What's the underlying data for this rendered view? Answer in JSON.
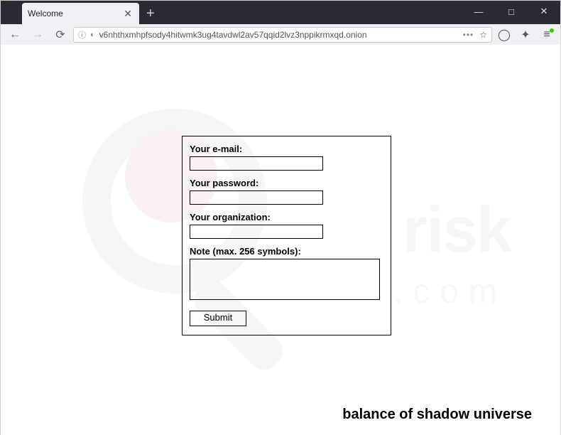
{
  "window": {
    "minimize": "—",
    "maximize": "□",
    "close": "✕"
  },
  "tab": {
    "title": "Welcome",
    "close": "✕",
    "new_tab": "+"
  },
  "addressbar": {
    "url": "v6nhthxmhpfsody4hitwmk3ug4tavdwl2av57qqid2lvz3nppikrmxqd.onion",
    "info_glyph": "ⓘ",
    "lock_glyph": "◐",
    "more": "•••",
    "star": "☆",
    "shield": "◯",
    "wand": "✦",
    "menu": "≡"
  },
  "nav": {
    "back": "←",
    "forward": "→",
    "reload": "⟳"
  },
  "form": {
    "email_label": "Your e-mail:",
    "email_value": "",
    "password_label": "Your password:",
    "password_value": "",
    "org_label": "Your organization:",
    "org_value": "",
    "note_label": "Note (max. 256 symbols):",
    "note_value": "",
    "submit_label": "Submit"
  },
  "footer": "balance of shadow universe",
  "watermark": {
    "brand": "risk",
    "domain": ".com"
  }
}
